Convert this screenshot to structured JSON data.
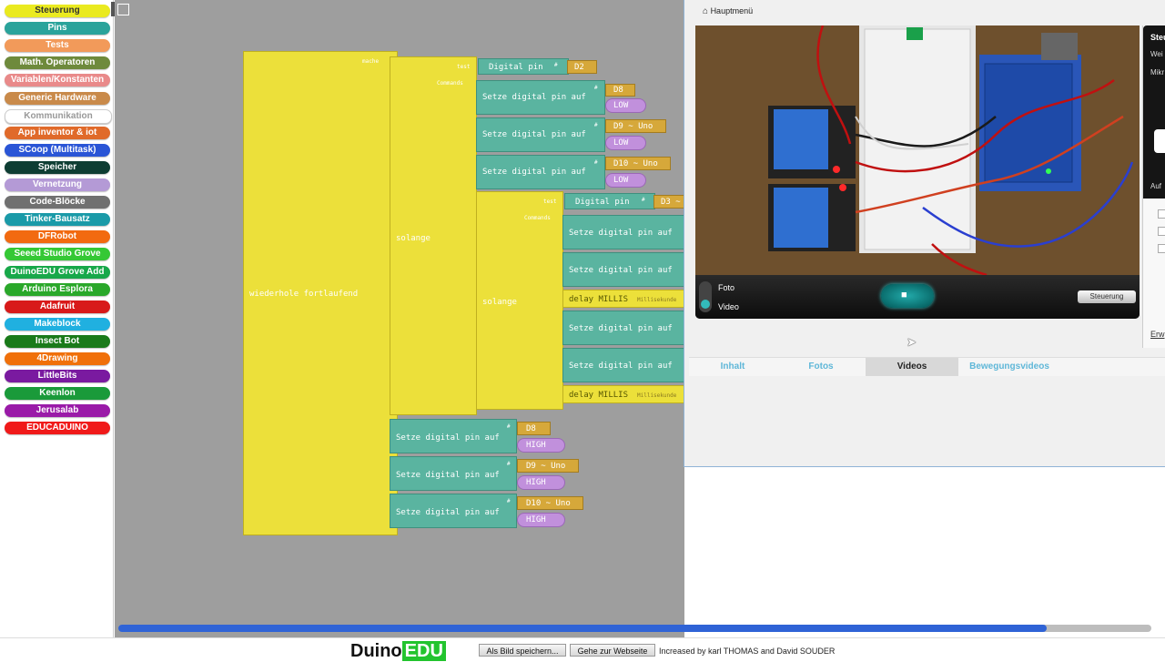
{
  "sidebar": {
    "categories": [
      {
        "label": "Steuerung",
        "color": "#eaea20",
        "text": "#333333"
      },
      {
        "label": "Pins",
        "color": "#2aa39b",
        "text": "#ffffff"
      },
      {
        "label": "Tests",
        "color": "#f29a5a",
        "text": "#ffffff"
      },
      {
        "label": "Math. Operatoren",
        "color": "#6e8a3c",
        "text": "#ffffff"
      },
      {
        "label": "Variablen/Konstanten",
        "color": "#e98a8a",
        "text": "#ffffff"
      },
      {
        "label": "Generic Hardware",
        "color": "#c98a4a",
        "text": "#ffffff"
      },
      {
        "label": "Kommunikation",
        "color": "#ffffff",
        "text": "#999999"
      },
      {
        "label": "App inventor & iot",
        "color": "#e06a2a",
        "text": "#ffffff"
      },
      {
        "label": "SCoop (Multitask)",
        "color": "#2a55d6",
        "text": "#ffffff"
      },
      {
        "label": "Speicher",
        "color": "#0e3d33",
        "text": "#ffffff"
      },
      {
        "label": "Vernetzung",
        "color": "#b49ad6",
        "text": "#ffffff"
      },
      {
        "label": "Code-Blöcke",
        "color": "#707070",
        "text": "#ffffff"
      },
      {
        "label": "Tinker-Bausatz",
        "color": "#1a9aa8",
        "text": "#ffffff"
      },
      {
        "label": "DFRobot",
        "color": "#f26a10",
        "text": "#ffffff"
      },
      {
        "label": "Seeed Studio Grove",
        "color": "#35c835",
        "text": "#ffffff"
      },
      {
        "label": "DuinoEDU Grove Add",
        "color": "#18a84a",
        "text": "#ffffff"
      },
      {
        "label": "Arduino Esplora",
        "color": "#2aa82a",
        "text": "#ffffff"
      },
      {
        "label": "Adafruit",
        "color": "#d81a1a",
        "text": "#ffffff"
      },
      {
        "label": "Makeblock",
        "color": "#20b0e0",
        "text": "#ffffff"
      },
      {
        "label": "Insect Bot",
        "color": "#1a7a1a",
        "text": "#ffffff"
      },
      {
        "label": "4Drawing",
        "color": "#f0700a",
        "text": "#ffffff"
      },
      {
        "label": "LittleBits",
        "color": "#7a1aa0",
        "text": "#ffffff"
      },
      {
        "label": "Keenlon",
        "color": "#1a9a3a",
        "text": "#ffffff"
      },
      {
        "label": "Jerusalab",
        "color": "#9a1aa8",
        "text": "#ffffff"
      },
      {
        "label": "EDUCADUINO",
        "color": "#f01a1a",
        "text": "#ffffff"
      }
    ]
  },
  "workspace": {
    "loop": {
      "label": "wiederhole fortlaufend",
      "param": "mache"
    },
    "while1": {
      "label": "solange",
      "test": "test",
      "commands": "Commands",
      "condition": "Digital pin",
      "hash": "#",
      "pin": "D2"
    },
    "inner1": [
      {
        "label": "Setze digital pin auf",
        "hash": "#",
        "pin": "D8",
        "value": "LOW"
      },
      {
        "label": "Setze digital pin auf",
        "hash": "#",
        "pin": "D9 ~ Uno",
        "value": "LOW"
      },
      {
        "label": "Setze digital pin auf",
        "hash": "#",
        "pin": "D10 ~ Uno",
        "value": "LOW"
      }
    ],
    "while2": {
      "label": "solange",
      "test": "test",
      "commands": "Commands",
      "condition": "Digital pin",
      "hash": "#",
      "pin": "D3 ~"
    },
    "inner2": {
      "setze_label": "Setze digital pin auf",
      "delay_label": "delay MILLIS",
      "delay_unit": "Millisekunde"
    },
    "after": [
      {
        "label": "Setze digital pin auf",
        "hash": "#",
        "pin": "D8",
        "value": "HIGH"
      },
      {
        "label": "Setze digital pin auf",
        "hash": "#",
        "pin": "D9 ~ Uno",
        "value": "HIGH"
      },
      {
        "label": "Setze digital pin auf",
        "hash": "#",
        "pin": "D10 ~ Uno",
        "value": "HIGH"
      }
    ]
  },
  "camera": {
    "menu": "Hauptmenü",
    "mode_photo": "Foto",
    "mode_video": "Video",
    "control_button": "Steuerung",
    "tabs": [
      "Inhalt",
      "Fotos",
      "Videos",
      "Bewegungsvideos"
    ],
    "active_tab": "Videos",
    "side_panel": [
      "Steu",
      "Wei",
      "Mikr",
      "Auf",
      "Erw"
    ]
  },
  "bottom": {
    "logo_left": "Duino",
    "logo_right": "EDU",
    "save_image": "Als Bild speichern...",
    "goto_site": "Gehe zur Webseite",
    "credits": "Increased by karl THOMAS and David SOUDER"
  }
}
